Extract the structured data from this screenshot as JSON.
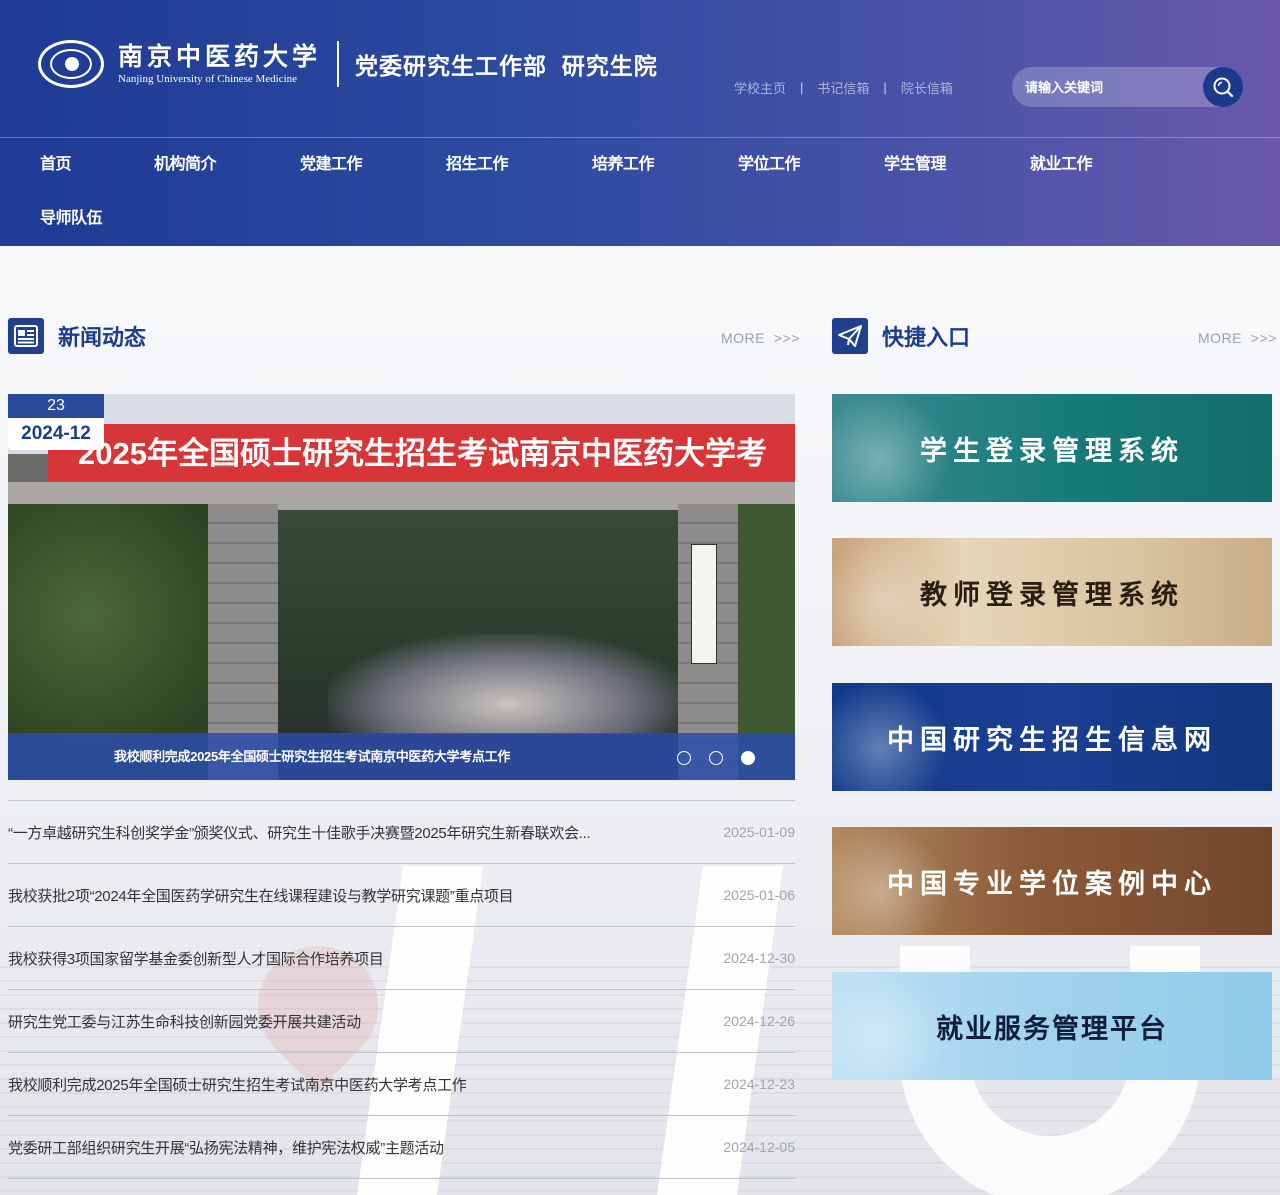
{
  "header": {
    "school_name_cn": "南京中医药大学",
    "school_name_en": "Nanjing University of Chinese Medicine",
    "department": "党委研究生工作部  研究生院",
    "top_links": [
      "学校主页",
      "书记信箱",
      "院长信箱"
    ],
    "separator": "|",
    "search": {
      "placeholder": "请输入关键词"
    }
  },
  "nav": {
    "items": [
      "首页",
      "机构简介",
      "党建工作",
      "招生工作",
      "培养工作",
      "学位工作",
      "学生管理",
      "就业工作",
      "导师队伍"
    ]
  },
  "news": {
    "title": "新闻动态",
    "more": "MORE  >>>",
    "slider": {
      "day": "23",
      "year_month": "2024-12",
      "banner_text": "2025年全国硕士研究生招生考试南京中医药大学考",
      "caption": "我校顺利完成2025年全国硕士研究生招生考试南京中医药大学考点工作",
      "slide_count": 3,
      "active_slide": 3
    },
    "items": [
      {
        "title": "“一方卓越研究生科创奖学金”颁奖仪式、研究生十佳歌手决赛暨2025年研究生新春联欢会...",
        "date": "2025-01-09"
      },
      {
        "title": "我校获批2项“2024年全国医药学研究生在线课程建设与教学研究课题”重点项目",
        "date": "2025-01-06"
      },
      {
        "title": "我校获得3项国家留学基金委创新型人才国际合作培养项目",
        "date": "2024-12-30"
      },
      {
        "title": "研究生党工委与江苏生命科技创新园党委开展共建活动",
        "date": "2024-12-26"
      },
      {
        "title": "我校顺利完成2025年全国硕士研究生招生考试南京中医药大学考点工作",
        "date": "2024-12-23"
      },
      {
        "title": "党委研工部组织研究生开展“弘扬宪法精神，维护宪法权威”主题活动",
        "date": "2024-12-05"
      }
    ]
  },
  "quick": {
    "title": "快捷入口",
    "more": "MORE  >>>",
    "items": [
      "学生登录管理系统",
      "教师登录管理系统",
      "中国研究生招生信息网",
      "中国专业学位案例中心",
      "就业服务管理平台"
    ]
  },
  "colors": {
    "primary": "#1d3c8e",
    "header_start": "#1f3b95",
    "header_end": "#6a58ad"
  }
}
